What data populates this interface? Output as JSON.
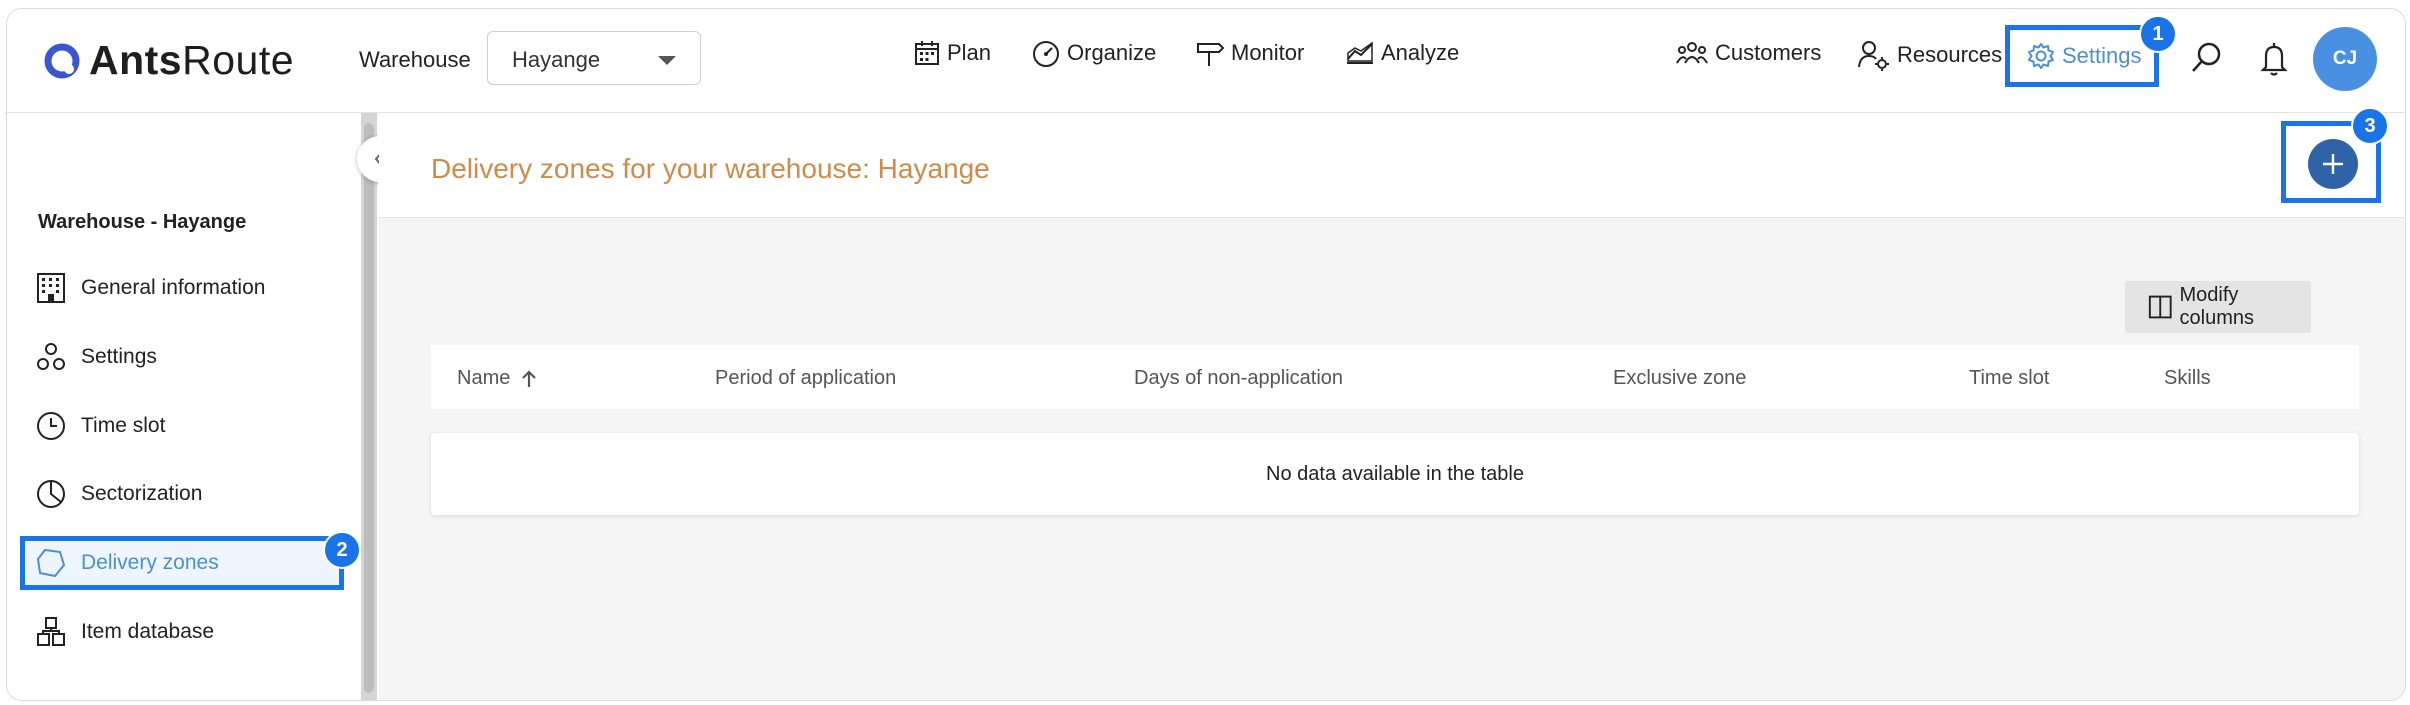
{
  "header": {
    "logo": {
      "bold": "Ants",
      "regular": "Route"
    },
    "warehouse_label": "Warehouse",
    "warehouse_value": "Hayange",
    "nav": {
      "plan": "Plan",
      "organize": "Organize",
      "monitor": "Monitor",
      "analyze": "Analyze"
    },
    "customers": "Customers",
    "resources": "Resources",
    "settings": "Settings",
    "avatar": "CJ"
  },
  "badges": {
    "one": "1",
    "two": "2",
    "three": "3"
  },
  "sidebar": {
    "title": "Warehouse - Hayange",
    "items": [
      {
        "label": "General information",
        "icon": "building-icon"
      },
      {
        "label": "Settings",
        "icon": "settings-nodes-icon"
      },
      {
        "label": "Time slot",
        "icon": "clock-icon"
      },
      {
        "label": "Sectorization",
        "icon": "pie-icon"
      },
      {
        "label": "Delivery zones",
        "icon": "polygon-icon"
      },
      {
        "label": "Item database",
        "icon": "boxes-icon"
      }
    ]
  },
  "main": {
    "title": "Delivery zones for your warehouse: Hayange",
    "modify_columns": "Modify columns",
    "columns": [
      "Name",
      "Period of application",
      "Days of non-application",
      "Exclusive zone",
      "Time slot",
      "Skills"
    ],
    "empty": "No data available in the table"
  },
  "colors": {
    "accent": "#1a73e8",
    "title": "#d08a4a",
    "add_button": "#2f62a6",
    "avatar": "#4a90e2"
  }
}
